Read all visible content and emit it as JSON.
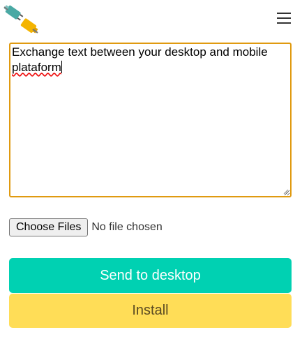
{
  "header": {
    "logo_icon": "plug-connector-icon",
    "menu_icon": "hamburger-menu-icon"
  },
  "editor": {
    "text_line1": "Exchange text between your desktop and mobile ",
    "text_misspelled": "plataform",
    "border_color": "#e09a10"
  },
  "file_input": {
    "button_label": "Choose Files",
    "status": "No file chosen"
  },
  "actions": {
    "send_label": "Send to desktop",
    "send_color": "#00d1b2",
    "install_label": "Install",
    "install_color": "#ffdd57"
  }
}
